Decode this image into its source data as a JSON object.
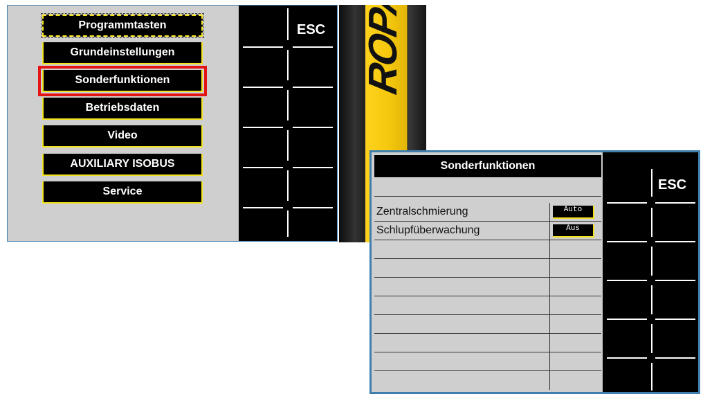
{
  "left_screen": {
    "menu": [
      {
        "label": "Programmtasten"
      },
      {
        "label": "Grundeinstellungen"
      },
      {
        "label": "Sonderfunktionen"
      },
      {
        "label": "Betriebsdaten"
      },
      {
        "label": "Video"
      },
      {
        "label": "AUXILIARY ISOBUS"
      },
      {
        "label": "Service"
      }
    ],
    "esc_label": "ESC"
  },
  "decal": {
    "logo_text": "ROPA"
  },
  "right_screen": {
    "title": "Sonderfunktionen",
    "rows": [
      {
        "label": "Zentralschmierung",
        "value": "Auto"
      },
      {
        "label": "Schlupfüberwachung",
        "value": "Aus"
      }
    ],
    "esc_label": "ESC"
  },
  "colors": {
    "accent_yellow": "#f3e31f",
    "highlight_red": "#e41414",
    "screen_gray": "#cfcfcf",
    "frame_blue": "#3f7fb0"
  }
}
